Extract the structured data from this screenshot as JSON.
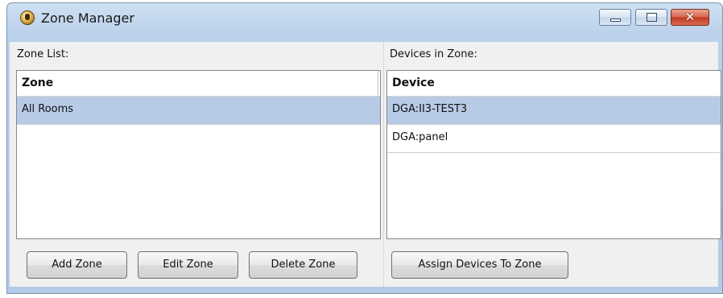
{
  "window": {
    "title": "Zone Manager",
    "close_glyph": "✕"
  },
  "zones": {
    "label": "Zone List:",
    "column_header": "Zone",
    "rows": [
      "All Rooms"
    ]
  },
  "devices": {
    "label": "Devices in Zone:",
    "column_header": "Device",
    "rows": [
      "DGA:II3-TEST3",
      "DGA:panel"
    ]
  },
  "buttons": {
    "add_zone": "Add Zone",
    "edit_zone": "Edit Zone",
    "delete_zone": "Delete Zone",
    "assign_devices": "Assign Devices To Zone"
  },
  "colors": {
    "selection": "#b7cbe6",
    "close_button": "#c0391f"
  }
}
